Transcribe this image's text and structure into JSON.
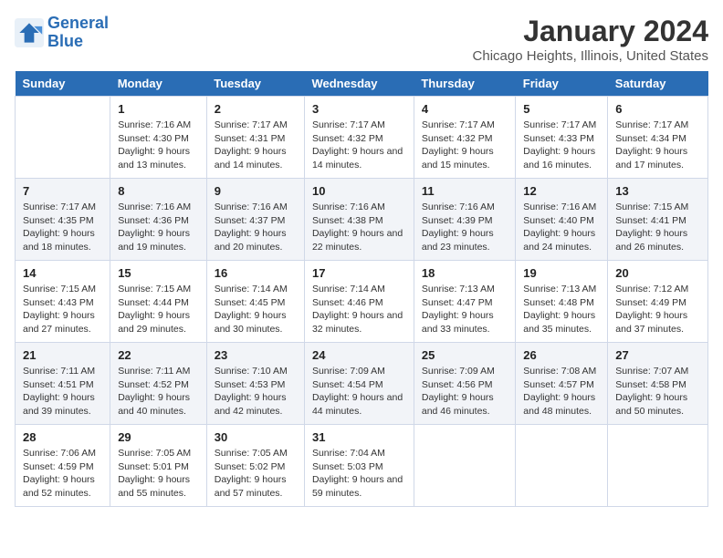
{
  "header": {
    "logo_line1": "General",
    "logo_line2": "Blue",
    "title": "January 2024",
    "subtitle": "Chicago Heights, Illinois, United States"
  },
  "days_of_week": [
    "Sunday",
    "Monday",
    "Tuesday",
    "Wednesday",
    "Thursday",
    "Friday",
    "Saturday"
  ],
  "weeks": [
    [
      {
        "num": "",
        "sunrise": "",
        "sunset": "",
        "daylight": ""
      },
      {
        "num": "1",
        "sunrise": "Sunrise: 7:16 AM",
        "sunset": "Sunset: 4:30 PM",
        "daylight": "Daylight: 9 hours and 13 minutes."
      },
      {
        "num": "2",
        "sunrise": "Sunrise: 7:17 AM",
        "sunset": "Sunset: 4:31 PM",
        "daylight": "Daylight: 9 hours and 14 minutes."
      },
      {
        "num": "3",
        "sunrise": "Sunrise: 7:17 AM",
        "sunset": "Sunset: 4:32 PM",
        "daylight": "Daylight: 9 hours and 14 minutes."
      },
      {
        "num": "4",
        "sunrise": "Sunrise: 7:17 AM",
        "sunset": "Sunset: 4:32 PM",
        "daylight": "Daylight: 9 hours and 15 minutes."
      },
      {
        "num": "5",
        "sunrise": "Sunrise: 7:17 AM",
        "sunset": "Sunset: 4:33 PM",
        "daylight": "Daylight: 9 hours and 16 minutes."
      },
      {
        "num": "6",
        "sunrise": "Sunrise: 7:17 AM",
        "sunset": "Sunset: 4:34 PM",
        "daylight": "Daylight: 9 hours and 17 minutes."
      }
    ],
    [
      {
        "num": "7",
        "sunrise": "Sunrise: 7:17 AM",
        "sunset": "Sunset: 4:35 PM",
        "daylight": "Daylight: 9 hours and 18 minutes."
      },
      {
        "num": "8",
        "sunrise": "Sunrise: 7:16 AM",
        "sunset": "Sunset: 4:36 PM",
        "daylight": "Daylight: 9 hours and 19 minutes."
      },
      {
        "num": "9",
        "sunrise": "Sunrise: 7:16 AM",
        "sunset": "Sunset: 4:37 PM",
        "daylight": "Daylight: 9 hours and 20 minutes."
      },
      {
        "num": "10",
        "sunrise": "Sunrise: 7:16 AM",
        "sunset": "Sunset: 4:38 PM",
        "daylight": "Daylight: 9 hours and 22 minutes."
      },
      {
        "num": "11",
        "sunrise": "Sunrise: 7:16 AM",
        "sunset": "Sunset: 4:39 PM",
        "daylight": "Daylight: 9 hours and 23 minutes."
      },
      {
        "num": "12",
        "sunrise": "Sunrise: 7:16 AM",
        "sunset": "Sunset: 4:40 PM",
        "daylight": "Daylight: 9 hours and 24 minutes."
      },
      {
        "num": "13",
        "sunrise": "Sunrise: 7:15 AM",
        "sunset": "Sunset: 4:41 PM",
        "daylight": "Daylight: 9 hours and 26 minutes."
      }
    ],
    [
      {
        "num": "14",
        "sunrise": "Sunrise: 7:15 AM",
        "sunset": "Sunset: 4:43 PM",
        "daylight": "Daylight: 9 hours and 27 minutes."
      },
      {
        "num": "15",
        "sunrise": "Sunrise: 7:15 AM",
        "sunset": "Sunset: 4:44 PM",
        "daylight": "Daylight: 9 hours and 29 minutes."
      },
      {
        "num": "16",
        "sunrise": "Sunrise: 7:14 AM",
        "sunset": "Sunset: 4:45 PM",
        "daylight": "Daylight: 9 hours and 30 minutes."
      },
      {
        "num": "17",
        "sunrise": "Sunrise: 7:14 AM",
        "sunset": "Sunset: 4:46 PM",
        "daylight": "Daylight: 9 hours and 32 minutes."
      },
      {
        "num": "18",
        "sunrise": "Sunrise: 7:13 AM",
        "sunset": "Sunset: 4:47 PM",
        "daylight": "Daylight: 9 hours and 33 minutes."
      },
      {
        "num": "19",
        "sunrise": "Sunrise: 7:13 AM",
        "sunset": "Sunset: 4:48 PM",
        "daylight": "Daylight: 9 hours and 35 minutes."
      },
      {
        "num": "20",
        "sunrise": "Sunrise: 7:12 AM",
        "sunset": "Sunset: 4:49 PM",
        "daylight": "Daylight: 9 hours and 37 minutes."
      }
    ],
    [
      {
        "num": "21",
        "sunrise": "Sunrise: 7:11 AM",
        "sunset": "Sunset: 4:51 PM",
        "daylight": "Daylight: 9 hours and 39 minutes."
      },
      {
        "num": "22",
        "sunrise": "Sunrise: 7:11 AM",
        "sunset": "Sunset: 4:52 PM",
        "daylight": "Daylight: 9 hours and 40 minutes."
      },
      {
        "num": "23",
        "sunrise": "Sunrise: 7:10 AM",
        "sunset": "Sunset: 4:53 PM",
        "daylight": "Daylight: 9 hours and 42 minutes."
      },
      {
        "num": "24",
        "sunrise": "Sunrise: 7:09 AM",
        "sunset": "Sunset: 4:54 PM",
        "daylight": "Daylight: 9 hours and 44 minutes."
      },
      {
        "num": "25",
        "sunrise": "Sunrise: 7:09 AM",
        "sunset": "Sunset: 4:56 PM",
        "daylight": "Daylight: 9 hours and 46 minutes."
      },
      {
        "num": "26",
        "sunrise": "Sunrise: 7:08 AM",
        "sunset": "Sunset: 4:57 PM",
        "daylight": "Daylight: 9 hours and 48 minutes."
      },
      {
        "num": "27",
        "sunrise": "Sunrise: 7:07 AM",
        "sunset": "Sunset: 4:58 PM",
        "daylight": "Daylight: 9 hours and 50 minutes."
      }
    ],
    [
      {
        "num": "28",
        "sunrise": "Sunrise: 7:06 AM",
        "sunset": "Sunset: 4:59 PM",
        "daylight": "Daylight: 9 hours and 52 minutes."
      },
      {
        "num": "29",
        "sunrise": "Sunrise: 7:05 AM",
        "sunset": "Sunset: 5:01 PM",
        "daylight": "Daylight: 9 hours and 55 minutes."
      },
      {
        "num": "30",
        "sunrise": "Sunrise: 7:05 AM",
        "sunset": "Sunset: 5:02 PM",
        "daylight": "Daylight: 9 hours and 57 minutes."
      },
      {
        "num": "31",
        "sunrise": "Sunrise: 7:04 AM",
        "sunset": "Sunset: 5:03 PM",
        "daylight": "Daylight: 9 hours and 59 minutes."
      },
      {
        "num": "",
        "sunrise": "",
        "sunset": "",
        "daylight": ""
      },
      {
        "num": "",
        "sunrise": "",
        "sunset": "",
        "daylight": ""
      },
      {
        "num": "",
        "sunrise": "",
        "sunset": "",
        "daylight": ""
      }
    ]
  ]
}
